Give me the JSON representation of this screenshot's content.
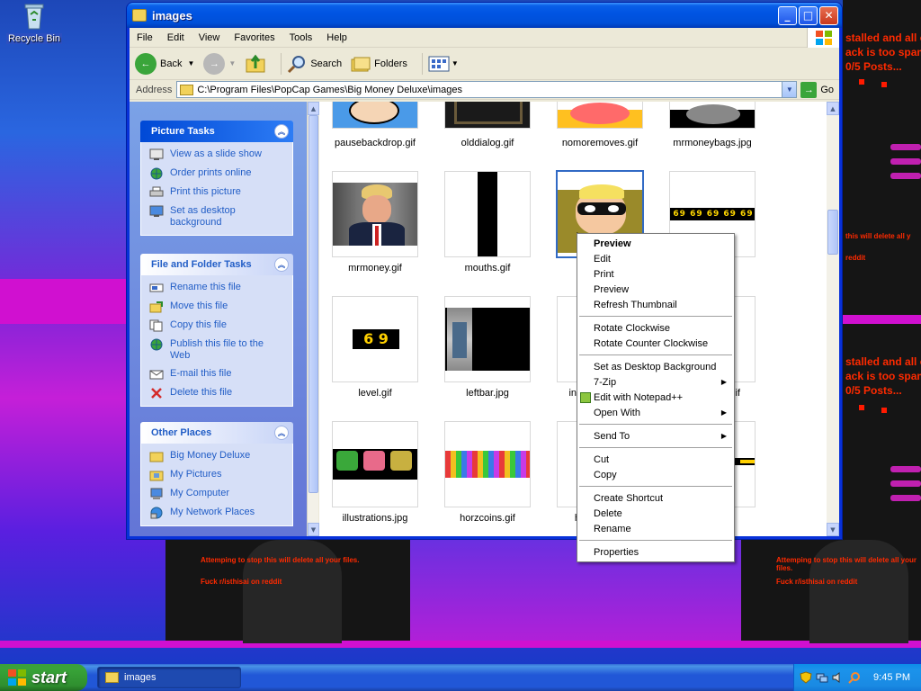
{
  "desktop": {
    "recycle_bin_label": "Recycle Bin",
    "overlay_text_1": "stalled and all c\nack is too spam\n0/5 Posts...",
    "overlay_text_2": "stalled and all c\nack is too spam\n0/5 Posts...",
    "warning_short": "this will delete all y",
    "reddit_short": "reddit",
    "warning_long": "Attemping to stop this will delete all your files.",
    "reddit_long": "Fuck r/isthisai on reddit",
    "warning_right_bottom": "Attemping to stop this will delete all your files.",
    "reddit_right_bottom": "Fuck r/isthisai on reddit"
  },
  "window": {
    "title": "images",
    "menu": [
      "File",
      "Edit",
      "View",
      "Favorites",
      "Tools",
      "Help"
    ],
    "toolbar": {
      "back": "Back",
      "search": "Search",
      "folders": "Folders"
    },
    "address": {
      "label": "Address",
      "value": "C:\\Program Files\\PopCap Games\\Big Money Deluxe\\images",
      "go": "Go"
    }
  },
  "left_panel": {
    "picture_tasks": {
      "title": "Picture Tasks",
      "items": [
        "View as a slide show",
        "Order prints online",
        "Print this picture",
        "Set as desktop background"
      ]
    },
    "file_folder_tasks": {
      "title": "File and Folder Tasks",
      "items": [
        "Rename this file",
        "Move this file",
        "Copy this file",
        "Publish this file to the Web",
        "E-mail this file",
        "Delete this file"
      ]
    },
    "other_places": {
      "title": "Other Places",
      "items": [
        "Big Money Deluxe",
        "My Pictures",
        "My Computer",
        "My Network Places"
      ]
    }
  },
  "files": {
    "row1": [
      "pausebackdrop.gif",
      "olddialog.gif",
      "nomoremoves.gif",
      "mrmoneybags.jpg"
    ],
    "row2": [
      "mrmoney.gif",
      "mouths.gif",
      "",
      "f"
    ],
    "row3": [
      "level.gif",
      "leftbar.jpg",
      "inst",
      "s.gif"
    ],
    "row4": [
      "illustrations.jpg",
      "horzcoins.gif",
      "he",
      ""
    ],
    "level_thumb_text": "6 9",
    "digits_thumb_text": "69 69 69 69 69"
  },
  "context_menu": {
    "items": [
      {
        "label": "Preview",
        "bold": true
      },
      {
        "label": "Edit"
      },
      {
        "label": "Print"
      },
      {
        "label": "Preview"
      },
      {
        "label": "Refresh Thumbnail"
      },
      {
        "label": "Rotate Clockwise"
      },
      {
        "label": "Rotate Counter Clockwise"
      },
      {
        "label": "Set as Desktop Background"
      },
      {
        "label": "7-Zip"
      },
      {
        "label": "Edit with Notepad++"
      },
      {
        "label": "Open With"
      },
      {
        "label": "Send To"
      },
      {
        "label": "Cut"
      },
      {
        "label": "Copy"
      },
      {
        "label": "Create Shortcut"
      },
      {
        "label": "Delete"
      },
      {
        "label": "Rename"
      },
      {
        "label": "Properties"
      }
    ]
  },
  "taskbar": {
    "start_label": "start",
    "task_label": "images",
    "clock": "9:45 PM"
  },
  "colors": {
    "xp_blue": "#0054e3",
    "task_link": "#215dc6",
    "start_green": "#3c9e3c",
    "warning_red": "#ff2a00"
  }
}
